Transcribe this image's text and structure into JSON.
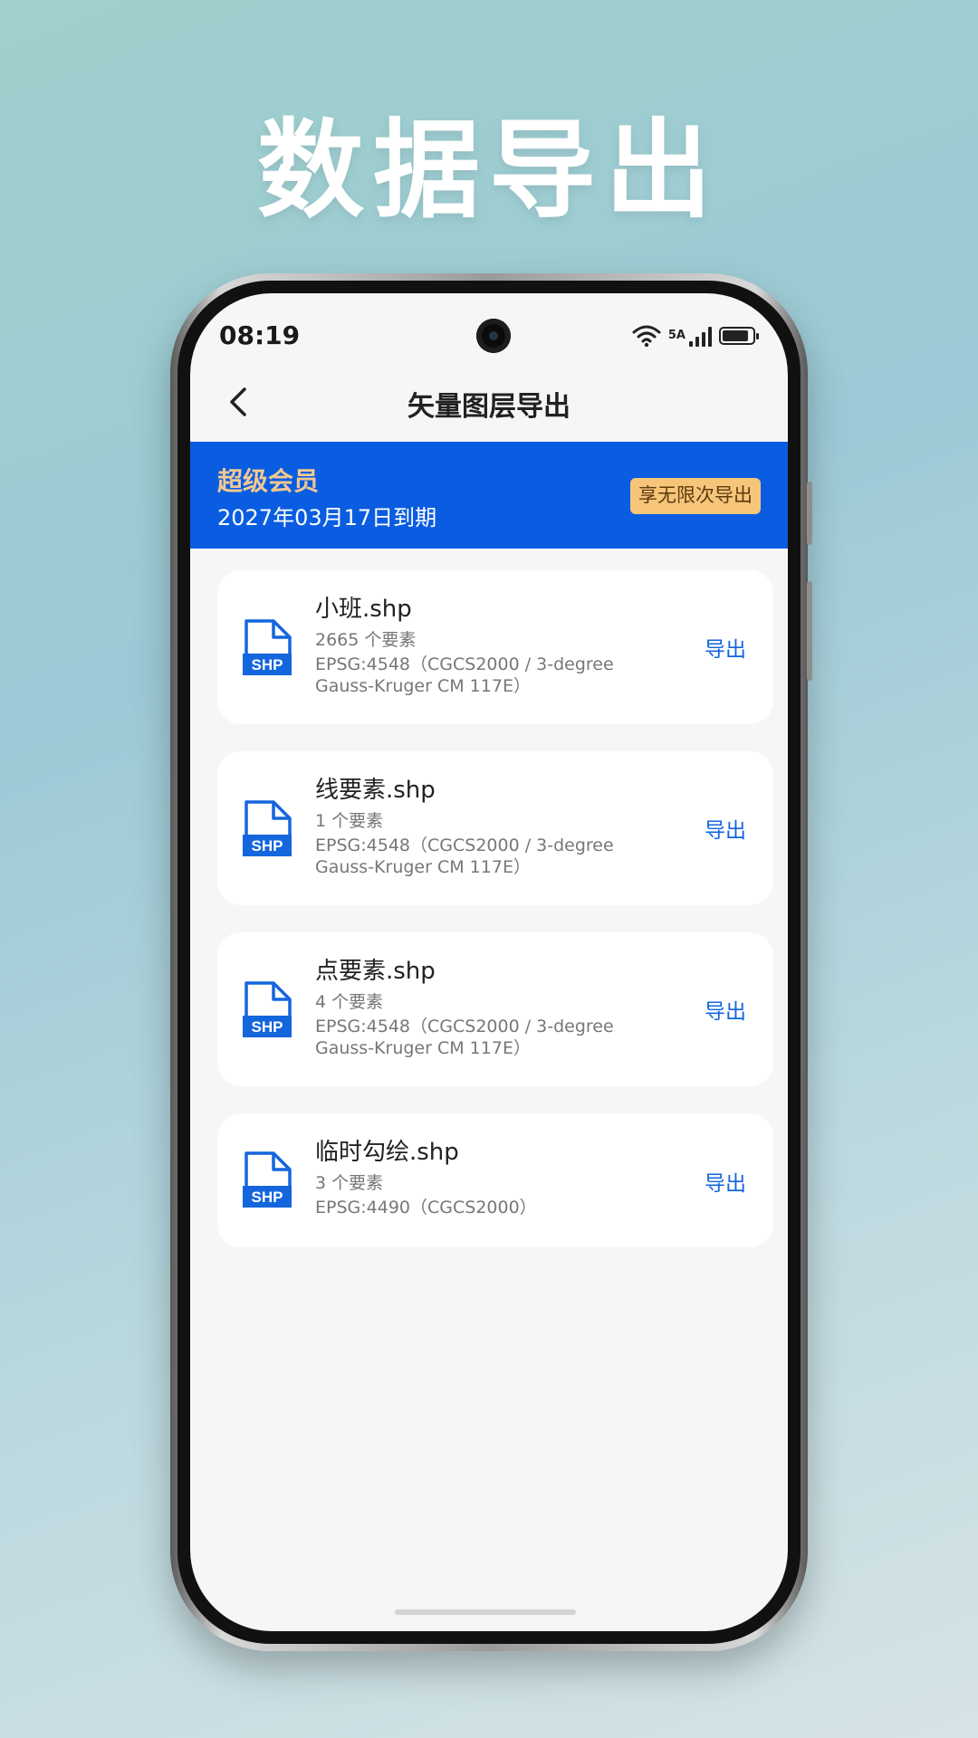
{
  "hero": {
    "title": "数据导出"
  },
  "status_bar": {
    "time": "08:19",
    "network_label": "5A"
  },
  "nav": {
    "title": "矢量图层导出"
  },
  "vip": {
    "title": "超级会员",
    "expire": "2027年03月17日到期",
    "button": "享无限次导出"
  },
  "layers": [
    {
      "name": "小班.shp",
      "count": "2665 个要素",
      "crs": "EPSG:4548（CGCS2000 / 3-degree Gauss-Kruger CM 117E）",
      "export": "导出",
      "icon_text": "SHP"
    },
    {
      "name": "线要素.shp",
      "count": "1 个要素",
      "crs": "EPSG:4548（CGCS2000 / 3-degree Gauss-Kruger CM 117E）",
      "export": "导出",
      "icon_text": "SHP"
    },
    {
      "name": "点要素.shp",
      "count": "4 个要素",
      "crs": "EPSG:4548（CGCS2000 / 3-degree Gauss-Kruger CM 117E）",
      "export": "导出",
      "icon_text": "SHP"
    },
    {
      "name": "临时勾绘.shp",
      "count": "3 个要素",
      "crs": "EPSG:4490（CGCS2000）",
      "export": "导出",
      "icon_text": "SHP"
    }
  ],
  "colors": {
    "accent": "#0a5de1",
    "link": "#1466dd",
    "vip_gold": "#f6c57a"
  }
}
